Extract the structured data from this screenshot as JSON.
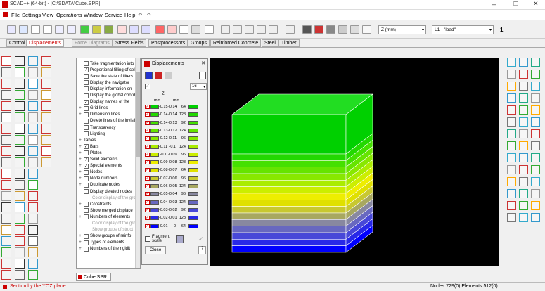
{
  "window": {
    "title": "SCAD++ (64-bit) - [C:\\SDATA\\Cube.SPR]"
  },
  "menu": [
    "File",
    "Settings",
    "View",
    "Operations",
    "Window",
    "Service",
    "Help"
  ],
  "toolbar": {
    "units": "Z (mm)",
    "load": "L1 - \"load\"",
    "counter": "1"
  },
  "tabs": [
    {
      "label": "Control",
      "state": "normal"
    },
    {
      "label": "Displacements",
      "state": "active"
    },
    {
      "label": "Force Diagrams",
      "state": "grey"
    },
    {
      "label": "Stress Fields",
      "state": "normal"
    },
    {
      "label": "Postprocessors",
      "state": "normal"
    },
    {
      "label": "Groups",
      "state": "normal"
    },
    {
      "label": "Reinforced Concrete",
      "state": "normal"
    },
    {
      "label": "Steel",
      "state": "normal"
    },
    {
      "label": "Timber",
      "state": "normal"
    }
  ],
  "tree": [
    {
      "label": "Take fragmentation into",
      "checked": false,
      "expander": "",
      "sub": false
    },
    {
      "label": "Proportional filling of cells",
      "checked": true,
      "expander": "",
      "sub": false
    },
    {
      "label": "Save the state of filters",
      "checked": false,
      "expander": "",
      "sub": false
    },
    {
      "label": "Display the navigator",
      "checked": false,
      "expander": "",
      "sub": false
    },
    {
      "label": "Display information on",
      "checked": false,
      "expander": "",
      "sub": false
    },
    {
      "label": "Display the global coord",
      "checked": false,
      "expander": "",
      "sub": false
    },
    {
      "label": "Display names of the",
      "checked": true,
      "expander": "",
      "sub": false
    },
    {
      "label": "Grid lines",
      "checked": false,
      "expander": "+",
      "sub": false
    },
    {
      "label": "Dimension lines",
      "checked": false,
      "expander": "+",
      "sub": false
    },
    {
      "label": "Delete lines of the invisible",
      "checked": false,
      "expander": "",
      "sub": false
    },
    {
      "label": "Transparency",
      "checked": false,
      "expander": "",
      "sub": false
    },
    {
      "label": "Lighting",
      "checked": false,
      "expander": "",
      "sub": false
    },
    {
      "label": "Tables",
      "checked": false,
      "expander": "+",
      "sub": false,
      "nocb": true
    },
    {
      "label": "Bars",
      "checked": true,
      "expander": "+",
      "sub": false
    },
    {
      "label": "Plates",
      "checked": false,
      "expander": "+",
      "sub": false
    },
    {
      "label": "Solid elements",
      "checked": true,
      "expander": "+",
      "sub": false
    },
    {
      "label": "Special elements",
      "checked": true,
      "expander": "+",
      "sub": false
    },
    {
      "label": "Nodes",
      "checked": false,
      "expander": "+",
      "sub": false
    },
    {
      "label": "Node numbers",
      "checked": false,
      "expander": "+",
      "sub": false
    },
    {
      "label": "Duplicate nodes",
      "checked": false,
      "expander": "+",
      "sub": false
    },
    {
      "label": "Display deleted nodes",
      "checked": false,
      "expander": "",
      "sub": false
    },
    {
      "label": "Color display of the gro",
      "checked": false,
      "expander": "",
      "sub": true
    },
    {
      "label": "Constraints",
      "checked": false,
      "expander": "+",
      "sub": false
    },
    {
      "label": "Show merged displace",
      "checked": false,
      "expander": "",
      "sub": false
    },
    {
      "label": "Numbers of elements",
      "checked": false,
      "expander": "+",
      "sub": false
    },
    {
      "label": "Color display of the gro",
      "checked": false,
      "expander": "",
      "sub": true
    },
    {
      "label": "Show groups of struct",
      "checked": false,
      "expander": "",
      "sub": true
    },
    {
      "label": "Show groups of reinfo",
      "checked": false,
      "expander": "+",
      "sub": false
    },
    {
      "label": "Types of elements",
      "checked": false,
      "expander": "+",
      "sub": false
    },
    {
      "label": "Numbers of the rigidit",
      "checked": false,
      "expander": "+",
      "sub": false
    }
  ],
  "displacements": {
    "title": "Displacements",
    "count": "16",
    "axis": "Z",
    "units": [
      "mm",
      "mm"
    ],
    "rows": [
      {
        "from": "-0.15",
        "to": "-0.14",
        "pct": "64",
        "color": "#00d000"
      },
      {
        "from": "-0.14",
        "to": "-0.14",
        "pct": "128",
        "color": "#22d800"
      },
      {
        "from": "-0.14",
        "to": "-0.13",
        "pct": "92",
        "color": "#44e000"
      },
      {
        "from": "-0.13",
        "to": "-0.12",
        "pct": "124",
        "color": "#66e400"
      },
      {
        "from": "-0.12",
        "to": "-0.11",
        "pct": "96",
        "color": "#88e800"
      },
      {
        "from": "-0.11",
        "to": "-0.1",
        "pct": "124",
        "color": "#aaec00"
      },
      {
        "from": "-0.1",
        "to": "-0.09",
        "pct": "96",
        "color": "#ccee00"
      },
      {
        "from": "-0.09",
        "to": "-0.08",
        "pct": "128",
        "color": "#eeee00"
      },
      {
        "from": "-0.08",
        "to": "-0.07",
        "pct": "64",
        "color": "#e0e000"
      },
      {
        "from": "-0.07",
        "to": "-0.06",
        "pct": "96",
        "color": "#c8c830"
      },
      {
        "from": "-0.06",
        "to": "-0.05",
        "pct": "124",
        "color": "#a8a860"
      },
      {
        "from": "-0.05",
        "to": "-0.04",
        "pct": "96",
        "color": "#8888a0"
      },
      {
        "from": "-0.04",
        "to": "-0.03",
        "pct": "124",
        "color": "#6868c0"
      },
      {
        "from": "-0.03",
        "to": "-0.02",
        "pct": "92",
        "color": "#4848d8"
      },
      {
        "from": "-0.02",
        "to": "-0.01",
        "pct": "128",
        "color": "#2828e8"
      },
      {
        "from": "-0.01",
        "to": "0",
        "pct": "64",
        "color": "#0000ff"
      }
    ],
    "fragment_label": "Fragment scale",
    "close_label": "Close"
  },
  "doc_tab": "Cube.SPR",
  "status": {
    "left": "Section by the YOZ plane",
    "right": "Nodes 729(0) Elements 512(0)"
  }
}
